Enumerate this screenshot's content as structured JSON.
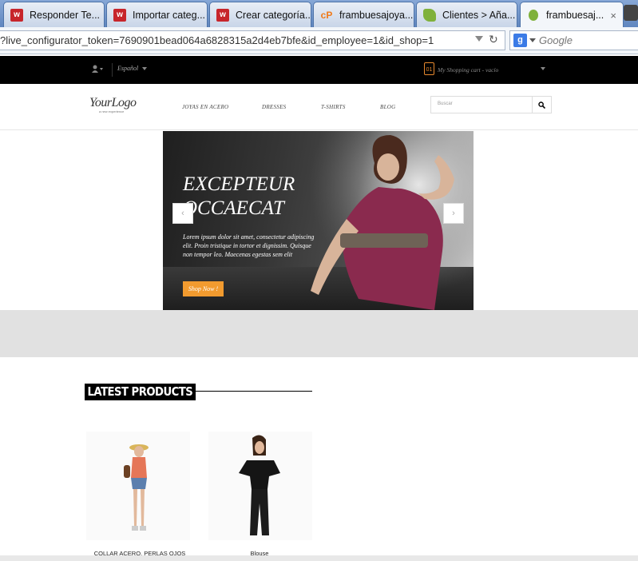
{
  "browser": {
    "tabs": [
      {
        "title": "Responder Te...",
        "favicon": "w-favicon-icon"
      },
      {
        "title": "Importar categ...",
        "favicon": "w-favicon-icon"
      },
      {
        "title": "Crear categoría...",
        "favicon": "w-favicon-icon"
      },
      {
        "title": "frambuesajoya...",
        "favicon": "cpanel-favicon-icon"
      },
      {
        "title": "Clientes > Aña...",
        "favicon": "leaf-favicon-icon"
      },
      {
        "title": "frambuesaj...",
        "favicon": "prestashop-favicon-icon",
        "active": true
      }
    ],
    "close_glyph": "×",
    "url": "?live_configurator_token=7690901bead064a6828315a2d4eb7bfe&id_employee=1&id_shop=1",
    "search_engine_letter": "g",
    "search_placeholder": "Google"
  },
  "shop": {
    "topbar": {
      "user_icon": "user-icon",
      "language": "Español",
      "cart_count": "01",
      "cart_label": "My Shopping cart - vacío"
    },
    "logo": {
      "text": "YourLogo",
      "tagline": "a new experience"
    },
    "menu": [
      "JOYAS EN ACERO",
      "DRESSES",
      "T-SHIRTS",
      "BLOG"
    ],
    "search_placeholder": "Buscar",
    "slider": {
      "heading_line1": "EXCEPTEUR",
      "heading_line2": "OCCAECAT",
      "text": "Lorem ipsum dolor sit amet, consectetur adipiscing elit. Proin tristique in tortor et dignissim. Quisque non tempor leo. Maecenas egestas sem elit",
      "button": "Shop Now !",
      "prev_glyph": "‹",
      "next_glyph": "›"
    },
    "latest_title": "LATEST PRODUCTS",
    "products": [
      {
        "name": "COLLAR ACERO, PERLAS OJOS"
      },
      {
        "name": "Blouse"
      }
    ]
  }
}
